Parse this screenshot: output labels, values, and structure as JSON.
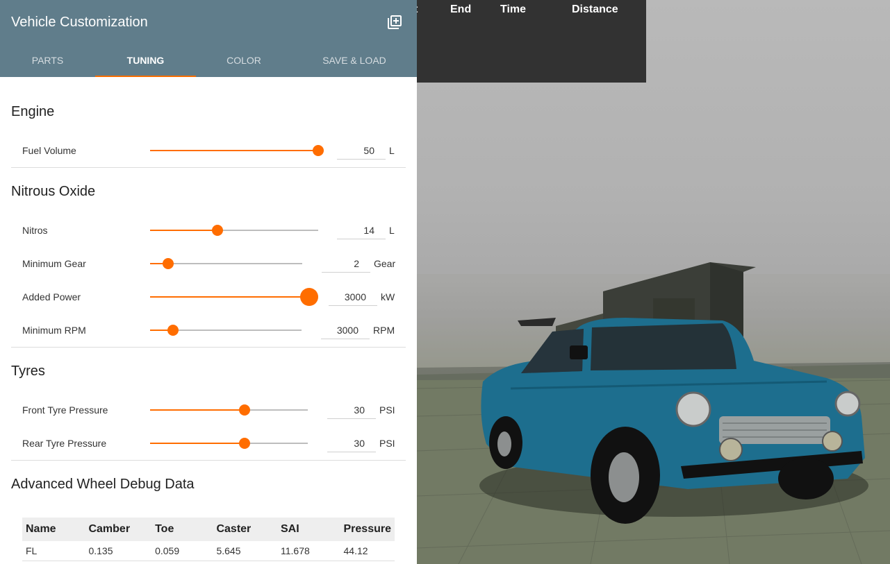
{
  "panel": {
    "title": "Vehicle Customization",
    "tabs": [
      {
        "label": "PARTS"
      },
      {
        "label": "TUNING"
      },
      {
        "label": "COLOR"
      },
      {
        "label": "SAVE & LOAD"
      }
    ]
  },
  "hud": {
    "columns": [
      "t",
      "End",
      "Time",
      "Distance"
    ]
  },
  "engine": {
    "title": "Engine",
    "fuel_volume": {
      "label": "Fuel Volume",
      "value": "50",
      "unit": "L",
      "fraction": 1.0
    }
  },
  "nitrous": {
    "title": "Nitrous Oxide",
    "nitros": {
      "label": "Nitros",
      "value": "14",
      "unit": "L",
      "fraction": 0.4
    },
    "min_gear": {
      "label": "Minimum Gear",
      "value": "2",
      "unit": "Gear",
      "fraction": 0.12
    },
    "added_power": {
      "label": "Added Power",
      "value": "3000",
      "unit": "kW",
      "fraction": 1.0
    },
    "min_rpm": {
      "label": "Minimum RPM",
      "value": "3000",
      "unit": "RPM",
      "fraction": 0.15
    }
  },
  "tyres": {
    "title": "Tyres",
    "front": {
      "label": "Front Tyre Pressure",
      "value": "30",
      "unit": "PSI",
      "fraction": 0.6
    },
    "rear": {
      "label": "Rear Tyre Pressure",
      "value": "30",
      "unit": "PSI",
      "fraction": 0.6
    }
  },
  "debug": {
    "title": "Advanced Wheel Debug Data",
    "headers": [
      "Name",
      "Camber",
      "Toe",
      "Caster",
      "SAI",
      "Pressure"
    ],
    "rows": [
      [
        "FL",
        "0.135",
        "0.059",
        "5.645",
        "11.678",
        "44.12"
      ]
    ]
  },
  "colors": {
    "header_bg": "#607d8b",
    "accent": "#ff6d00",
    "car_body": "#1d6e8e"
  }
}
